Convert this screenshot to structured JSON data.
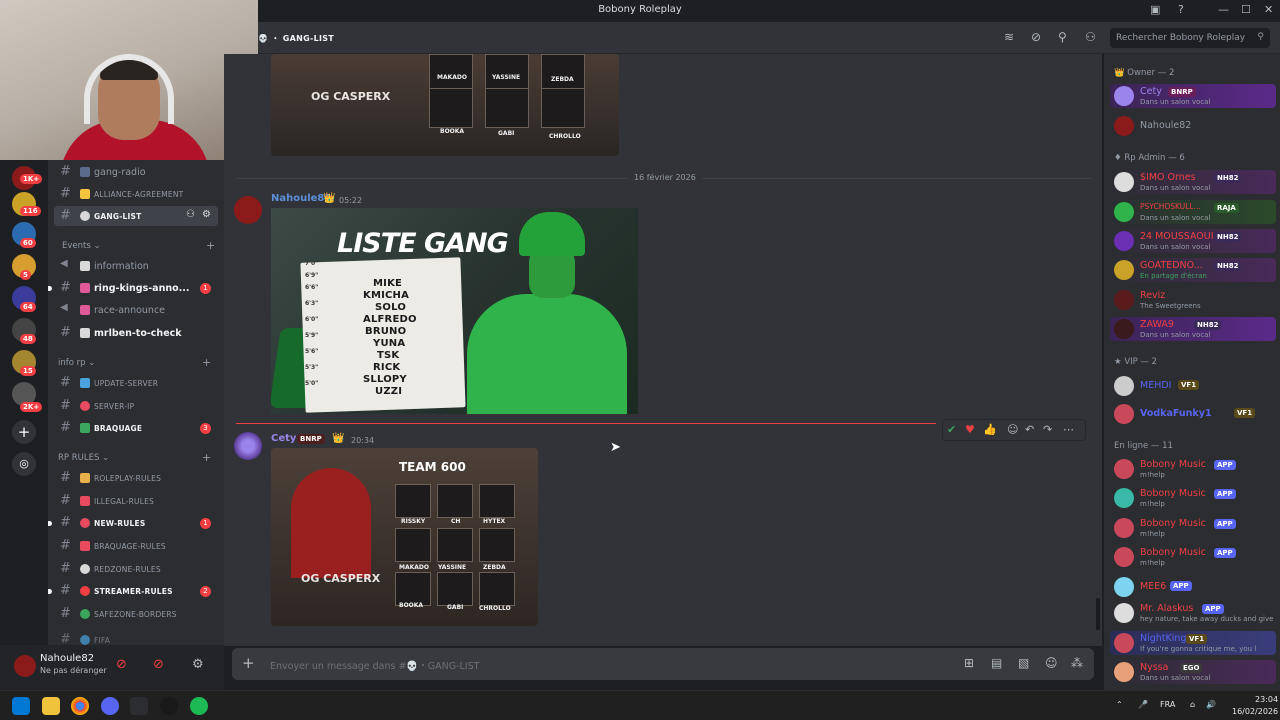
{
  "window": {
    "title": "Bobony Roleplay",
    "controls": [
      "—",
      "☐",
      "✕"
    ]
  },
  "servers": {
    "badges": [
      "1K+",
      "116",
      "60",
      "5",
      "64",
      "48",
      "15",
      "2K+"
    ]
  },
  "channels": {
    "items": [
      {
        "name": "gang-radio"
      },
      {
        "name": "ALLIANCE-AGREEMENT"
      },
      {
        "name": "GANG-LIST"
      },
      {
        "category": "Events"
      },
      {
        "name": "information"
      },
      {
        "name": "ring-kings-anno...",
        "badge": "1"
      },
      {
        "name": "race-announce"
      },
      {
        "name": "mrlben-to-check"
      },
      {
        "category": "info rp"
      },
      {
        "name": "UPDATE-SERVER"
      },
      {
        "name": "SERVER-IP"
      },
      {
        "name": "BRAQUAGE",
        "badge": "3"
      },
      {
        "category": "RP RULES"
      },
      {
        "name": "ROLEPLAY-RULES"
      },
      {
        "name": "ILLEGAL-RULES"
      },
      {
        "name": "NEW-RULES",
        "badge": "1"
      },
      {
        "name": "BRAQUAGE-RULES"
      },
      {
        "name": "REDZONE-RULES"
      },
      {
        "name": "STREAMER-RULES",
        "badge": "2"
      },
      {
        "name": "SAFEZONE-BORDERS"
      },
      {
        "name": "FIFA"
      }
    ]
  },
  "user": {
    "name": "Nahoule82",
    "status": "Ne pas déranger"
  },
  "header": {
    "channel": "GANG-LIST",
    "search_placeholder": "Rechercher Bobony Roleplay"
  },
  "chat": {
    "date_divider": "16 février 2026",
    "gang_image_top": {
      "label": "OG CASPERX",
      "members": [
        "MAKADO",
        "YASSINE",
        "ZEBDA",
        "BOOKA",
        "GABI",
        "CHROLLO"
      ]
    },
    "messages": [
      {
        "author": "Nahoule82",
        "time": "05:22",
        "image": {
          "title": "LISTE GANG",
          "heights": [
            "7'0\"",
            "6'9\"",
            "6'6\"",
            "6'3\"",
            "6'0\"",
            "5'9\"",
            "5'6\"",
            "5'3\"",
            "5'0\""
          ],
          "names": [
            "MIKE",
            "KMICHA",
            "SOLO",
            "ALFREDO",
            "BRUNO",
            "YUNA",
            "TSK",
            "RICK",
            "SLLOPY",
            "UZZI"
          ]
        }
      },
      {
        "author": "Cety",
        "tag": "BNRP",
        "time": "20:34",
        "image": {
          "title": "TEAM 600",
          "label": "OG CASPERX",
          "members": [
            "RISSKY",
            "CH",
            "HYTEX",
            "MAKADO",
            "YASSINE",
            "ZEBDA",
            "BOOKA",
            "GABI",
            "CHROLLO"
          ]
        }
      }
    ],
    "composer_placeholder": "Envoyer un message dans #💀・GANG-LIST"
  },
  "members": {
    "groups": [
      {
        "header": "Owner — 2"
      },
      {
        "header": "Rp Admin — 6"
      },
      {
        "header": "VIP — 2"
      },
      {
        "header": "En ligne — 11"
      }
    ],
    "list": [
      {
        "name": "Cety",
        "tag": "BNRP",
        "sub": "Dans un salon vocal",
        "color": "#9b84ec"
      },
      {
        "name": "Nahoule82",
        "sub": "",
        "color": "#949ba4"
      },
      {
        "name": "$IMO Ornes",
        "tag": "NH82",
        "sub": "Dans un salon vocal",
        "color": "#f23f43"
      },
      {
        "name": "PSYCHOSKULL...",
        "tag": "RAJA",
        "sub": "Dans un salon vocal",
        "color": "#f23f43"
      },
      {
        "name": "24 MOUSSAOUI",
        "tag": "NH82",
        "sub": "Dans un salon vocal",
        "color": "#f23f43"
      },
      {
        "name": "GOATEDNO...",
        "tag": "NH82",
        "sub": "En partage d'écran",
        "color": "#f23f43"
      },
      {
        "name": "Reviz",
        "sub": "The Sweetgreens",
        "color": "#f23f43"
      },
      {
        "name": "ZAWA9",
        "tag": "NH82",
        "sub": "Dans un salon vocal",
        "color": "#f23f43"
      },
      {
        "name": "MEHDI",
        "tag": "VF1",
        "sub": "",
        "color": "#5865f2"
      },
      {
        "name": "VodkaFunky1",
        "tag": "VF1",
        "sub": "",
        "color": "#5865f2"
      },
      {
        "name": "Bobony Music",
        "tag": "APP",
        "sub": "m!help",
        "color": "#f23f43"
      },
      {
        "name": "Bobony Music",
        "tag": "APP",
        "sub": "m!help",
        "color": "#f23f43"
      },
      {
        "name": "Bobony Music",
        "tag": "APP",
        "sub": "m!help",
        "color": "#f23f43"
      },
      {
        "name": "Bobony Music",
        "tag": "APP",
        "sub": "m!help",
        "color": "#f23f43"
      },
      {
        "name": "MEE6",
        "tag": "APP",
        "sub": "",
        "color": "#f23f43"
      },
      {
        "name": "Mr. Alaskus",
        "tag": "APP",
        "sub": "hey nature, take away ducks and give",
        "color": "#f23f43"
      },
      {
        "name": "NightKing",
        "tag": "VF1",
        "sub": "If you're gonna critique me, you l",
        "color": "#5865f2"
      },
      {
        "name": "Nyssa",
        "tag": "EGO",
        "sub": "Dans un salon vocal",
        "color": "#f23f43"
      }
    ]
  },
  "taskbar": {
    "lang": "FRA",
    "time": "23:04",
    "date": "16/02/2026"
  },
  "colors": {
    "accent": "#5865f2",
    "danger": "#f23f43",
    "bg": "#313338",
    "sidebar": "#2b2d31"
  }
}
